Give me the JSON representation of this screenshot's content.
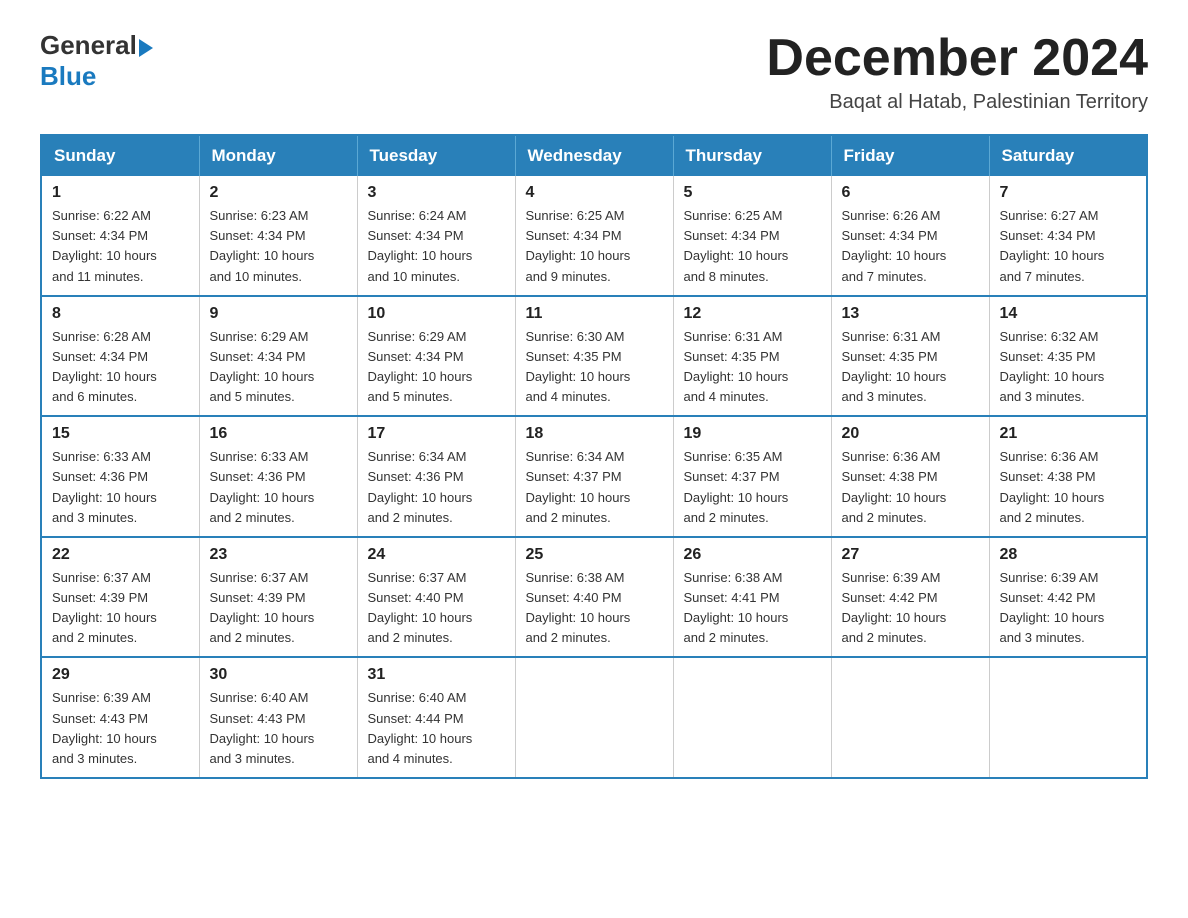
{
  "logo": {
    "text_general": "General",
    "text_blue": "Blue",
    "icon": "▶"
  },
  "header": {
    "month_title": "December 2024",
    "subtitle": "Baqat al Hatab, Palestinian Territory"
  },
  "weekdays": [
    "Sunday",
    "Monday",
    "Tuesday",
    "Wednesday",
    "Thursday",
    "Friday",
    "Saturday"
  ],
  "weeks": [
    [
      {
        "day": "1",
        "sunrise": "6:22 AM",
        "sunset": "4:34 PM",
        "daylight": "10 hours and 11 minutes."
      },
      {
        "day": "2",
        "sunrise": "6:23 AM",
        "sunset": "4:34 PM",
        "daylight": "10 hours and 10 minutes."
      },
      {
        "day": "3",
        "sunrise": "6:24 AM",
        "sunset": "4:34 PM",
        "daylight": "10 hours and 10 minutes."
      },
      {
        "day": "4",
        "sunrise": "6:25 AM",
        "sunset": "4:34 PM",
        "daylight": "10 hours and 9 minutes."
      },
      {
        "day": "5",
        "sunrise": "6:25 AM",
        "sunset": "4:34 PM",
        "daylight": "10 hours and 8 minutes."
      },
      {
        "day": "6",
        "sunrise": "6:26 AM",
        "sunset": "4:34 PM",
        "daylight": "10 hours and 7 minutes."
      },
      {
        "day": "7",
        "sunrise": "6:27 AM",
        "sunset": "4:34 PM",
        "daylight": "10 hours and 7 minutes."
      }
    ],
    [
      {
        "day": "8",
        "sunrise": "6:28 AM",
        "sunset": "4:34 PM",
        "daylight": "10 hours and 6 minutes."
      },
      {
        "day": "9",
        "sunrise": "6:29 AM",
        "sunset": "4:34 PM",
        "daylight": "10 hours and 5 minutes."
      },
      {
        "day": "10",
        "sunrise": "6:29 AM",
        "sunset": "4:34 PM",
        "daylight": "10 hours and 5 minutes."
      },
      {
        "day": "11",
        "sunrise": "6:30 AM",
        "sunset": "4:35 PM",
        "daylight": "10 hours and 4 minutes."
      },
      {
        "day": "12",
        "sunrise": "6:31 AM",
        "sunset": "4:35 PM",
        "daylight": "10 hours and 4 minutes."
      },
      {
        "day": "13",
        "sunrise": "6:31 AM",
        "sunset": "4:35 PM",
        "daylight": "10 hours and 3 minutes."
      },
      {
        "day": "14",
        "sunrise": "6:32 AM",
        "sunset": "4:35 PM",
        "daylight": "10 hours and 3 minutes."
      }
    ],
    [
      {
        "day": "15",
        "sunrise": "6:33 AM",
        "sunset": "4:36 PM",
        "daylight": "10 hours and 3 minutes."
      },
      {
        "day": "16",
        "sunrise": "6:33 AM",
        "sunset": "4:36 PM",
        "daylight": "10 hours and 2 minutes."
      },
      {
        "day": "17",
        "sunrise": "6:34 AM",
        "sunset": "4:36 PM",
        "daylight": "10 hours and 2 minutes."
      },
      {
        "day": "18",
        "sunrise": "6:34 AM",
        "sunset": "4:37 PM",
        "daylight": "10 hours and 2 minutes."
      },
      {
        "day": "19",
        "sunrise": "6:35 AM",
        "sunset": "4:37 PM",
        "daylight": "10 hours and 2 minutes."
      },
      {
        "day": "20",
        "sunrise": "6:36 AM",
        "sunset": "4:38 PM",
        "daylight": "10 hours and 2 minutes."
      },
      {
        "day": "21",
        "sunrise": "6:36 AM",
        "sunset": "4:38 PM",
        "daylight": "10 hours and 2 minutes."
      }
    ],
    [
      {
        "day": "22",
        "sunrise": "6:37 AM",
        "sunset": "4:39 PM",
        "daylight": "10 hours and 2 minutes."
      },
      {
        "day": "23",
        "sunrise": "6:37 AM",
        "sunset": "4:39 PM",
        "daylight": "10 hours and 2 minutes."
      },
      {
        "day": "24",
        "sunrise": "6:37 AM",
        "sunset": "4:40 PM",
        "daylight": "10 hours and 2 minutes."
      },
      {
        "day": "25",
        "sunrise": "6:38 AM",
        "sunset": "4:40 PM",
        "daylight": "10 hours and 2 minutes."
      },
      {
        "day": "26",
        "sunrise": "6:38 AM",
        "sunset": "4:41 PM",
        "daylight": "10 hours and 2 minutes."
      },
      {
        "day": "27",
        "sunrise": "6:39 AM",
        "sunset": "4:42 PM",
        "daylight": "10 hours and 2 minutes."
      },
      {
        "day": "28",
        "sunrise": "6:39 AM",
        "sunset": "4:42 PM",
        "daylight": "10 hours and 3 minutes."
      }
    ],
    [
      {
        "day": "29",
        "sunrise": "6:39 AM",
        "sunset": "4:43 PM",
        "daylight": "10 hours and 3 minutes."
      },
      {
        "day": "30",
        "sunrise": "6:40 AM",
        "sunset": "4:43 PM",
        "daylight": "10 hours and 3 minutes."
      },
      {
        "day": "31",
        "sunrise": "6:40 AM",
        "sunset": "4:44 PM",
        "daylight": "10 hours and 4 minutes."
      },
      null,
      null,
      null,
      null
    ]
  ],
  "labels": {
    "sunrise": "Sunrise:",
    "sunset": "Sunset:",
    "daylight": "Daylight:"
  }
}
